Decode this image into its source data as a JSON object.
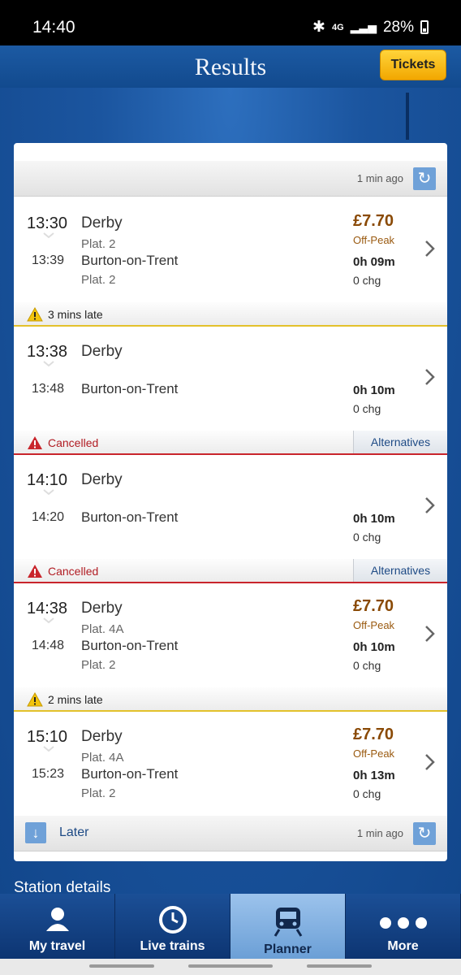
{
  "status_bar": {
    "time": "14:40",
    "network": "4G",
    "battery": "28%"
  },
  "header": {
    "title": "Results",
    "tickets_label": "Tickets"
  },
  "top_refresh": {
    "ago": "1 min ago"
  },
  "journeys": [
    {
      "dep_time": "13:30",
      "from": "Derby",
      "from_plat": "Plat. 2",
      "arr_time": "13:39",
      "to": "Burton-on-Trent",
      "to_plat": "Plat. 2",
      "price": "£7.70",
      "fare": "Off-Peak",
      "duration": "0h 09m",
      "changes": "0 chg"
    },
    {
      "dep_time": "13:38",
      "from": "Derby",
      "from_plat": "",
      "arr_time": "13:48",
      "to": "Burton-on-Trent",
      "to_plat": "",
      "price": "",
      "fare": "",
      "duration": "0h 10m",
      "changes": "0 chg"
    },
    {
      "dep_time": "14:10",
      "from": "Derby",
      "from_plat": "",
      "arr_time": "14:20",
      "to": "Burton-on-Trent",
      "to_plat": "",
      "price": "",
      "fare": "",
      "duration": "0h 10m",
      "changes": "0 chg"
    },
    {
      "dep_time": "14:38",
      "from": "Derby",
      "from_plat": "Plat. 4A",
      "arr_time": "14:48",
      "to": "Burton-on-Trent",
      "to_plat": "Plat. 2",
      "price": "£7.70",
      "fare": "Off-Peak",
      "duration": "0h 10m",
      "changes": "0 chg"
    },
    {
      "dep_time": "15:10",
      "from": "Derby",
      "from_plat": "Plat. 4A",
      "arr_time": "15:23",
      "to": "Burton-on-Trent",
      "to_plat": "Plat. 2",
      "price": "£7.70",
      "fare": "Off-Peak",
      "duration": "0h 13m",
      "changes": "0 chg"
    }
  ],
  "statuses": [
    {
      "message": "3 mins late"
    },
    {
      "message": "Cancelled",
      "action": "Alternatives"
    },
    {
      "message": "Cancelled",
      "action": "Alternatives"
    },
    {
      "message": "2 mins late"
    }
  ],
  "bottom_refresh": {
    "later_label": "Later",
    "ago": "1 min ago"
  },
  "station_details_label": "Station details",
  "tabs": [
    {
      "label": "My travel",
      "icon": "person-icon"
    },
    {
      "label": "Live trains",
      "icon": "clock-icon"
    },
    {
      "label": "Planner",
      "icon": "train-icon",
      "active": true
    },
    {
      "label": "More",
      "icon": "more-dots-icon"
    }
  ],
  "colors": {
    "brand_blue": "#124a8e",
    "tickets_yellow": "#f2a700",
    "price_brown": "#8a4a06",
    "late_yellow": "#e3c12b",
    "cancel_red": "#c9252c",
    "link_blue": "#1d4a85"
  }
}
